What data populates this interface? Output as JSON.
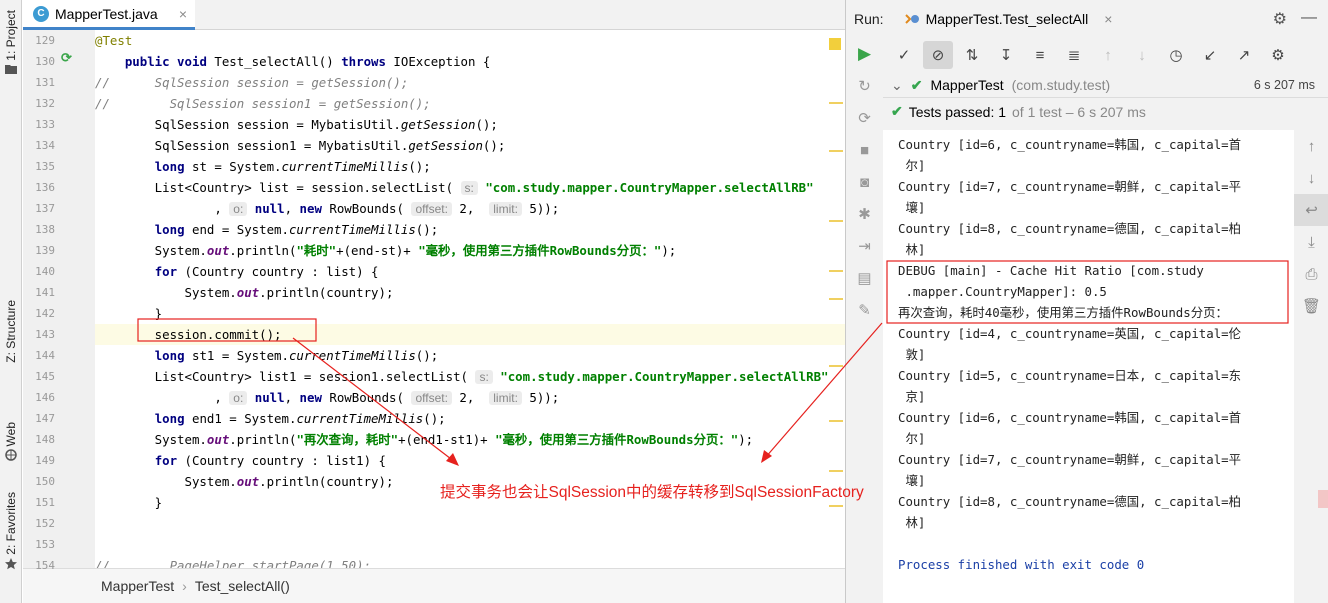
{
  "left_strip": {
    "project": "1: Project",
    "structure": "Z: Structure",
    "web": "Web",
    "favorites": "2: Favorites"
  },
  "editor": {
    "tab": {
      "icon": "C",
      "name": "MapperTest.java",
      "close": "×"
    },
    "lines": [
      {
        "n": "129",
        "html": "<span class=\"ann\">@Test</span>"
      },
      {
        "n": "130",
        "html": "    <span class=\"kw\">public void</span> Test_selectAll() <span class=\"kw\">throws</span> IOException {"
      },
      {
        "n": "131",
        "html": "<span class=\"cmt\">//      SqlSession session = getSession();</span>"
      },
      {
        "n": "132",
        "html": "<span class=\"cmt\">//        SqlSession session1 = getSession();</span>"
      },
      {
        "n": "133",
        "html": "        SqlSession session = MybatisUtil.<span class=\"stat\">getSession</span>();"
      },
      {
        "n": "134",
        "html": "        SqlSession session1 = MybatisUtil.<span class=\"stat\">getSession</span>();"
      },
      {
        "n": "135",
        "html": "        <span class=\"kw\">long</span> st = System.<span class=\"stat\">currentTimeMillis</span>();"
      },
      {
        "n": "136",
        "html": "        List&lt;Country&gt; list = session.selectList( <span class=\"hint\">s:</span> <span class=\"str\">\"com.study.mapper.CountryMapper.selectAllRB\"</span>"
      },
      {
        "n": "137",
        "html": "                , <span class=\"hint\">o:</span> <span class=\"kw\">null</span>, <span class=\"kw\">new</span> RowBounds( <span class=\"hint\">offset:</span> 2,  <span class=\"hint\">limit:</span> 5));"
      },
      {
        "n": "138",
        "html": "        <span class=\"kw\">long</span> end = System.<span class=\"stat\">currentTimeMillis</span>();"
      },
      {
        "n": "139",
        "html": "        System.<span class=\"fld\">out</span>.println(<span class=\"str\">\"耗时\"</span>+(end-st)+ <span class=\"str\">\"毫秒，使用第三方插件RowBounds分页：\"</span>);"
      },
      {
        "n": "140",
        "html": "        <span class=\"kw\">for</span> (Country country : list) {"
      },
      {
        "n": "141",
        "html": "            System.<span class=\"fld\">out</span>.println(country);"
      },
      {
        "n": "142",
        "html": "        }"
      },
      {
        "n": "143",
        "html": "        session.commit();",
        "hl": true
      },
      {
        "n": "144",
        "html": "        <span class=\"kw\">long</span> st1 = System.<span class=\"stat\">currentTimeMillis</span>();"
      },
      {
        "n": "145",
        "html": "        List&lt;Country&gt; list1 = session1.selectList( <span class=\"hint\">s:</span> <span class=\"str\">\"com.study.mapper.CountryMapper.selectAllRB\"</span>"
      },
      {
        "n": "146",
        "html": "                , <span class=\"hint\">o:</span> <span class=\"kw\">null</span>, <span class=\"kw\">new</span> RowBounds( <span class=\"hint\">offset:</span> 2,  <span class=\"hint\">limit:</span> 5));"
      },
      {
        "n": "147",
        "html": "        <span class=\"kw\">long</span> end1 = System.<span class=\"stat\">currentTimeMillis</span>();"
      },
      {
        "n": "148",
        "html": "        System.<span class=\"fld\">out</span>.println(<span class=\"str\">\"再次查询，耗时\"</span>+(end1-st1)+ <span class=\"str\">\"毫秒，使用第三方插件RowBounds分页：\"</span>);"
      },
      {
        "n": "149",
        "html": "        <span class=\"kw\">for</span> (Country country : list1) {"
      },
      {
        "n": "150",
        "html": "            System.<span class=\"fld\">out</span>.println(country);"
      },
      {
        "n": "151",
        "html": "        }"
      },
      {
        "n": "152",
        "html": ""
      },
      {
        "n": "153",
        "html": ""
      },
      {
        "n": "154",
        "html": "<span class=\"cmt\">//        PageHelper.startPage(1,50);</span>"
      }
    ],
    "breadcrumb": [
      "MapperTest",
      "Test_selectAll()"
    ],
    "breadcrumb_sep": "›"
  },
  "run": {
    "label": "Run:",
    "tab": "MapperTest.Test_selectAll",
    "tab_close": "×",
    "tree_root": "MapperTest",
    "tree_pkg": "(com.study.test)",
    "tree_time": "6 s 207 ms",
    "status_main": "Tests passed: 1",
    "status_rest": "of 1 test – 6 s 207 ms",
    "console": [
      "Country [id=6, c_countryname=韩国, c_capital=首",
      " 尔]",
      "Country [id=7, c_countryname=朝鲜, c_capital=平",
      " 壤]",
      "Country [id=8, c_countryname=德国, c_capital=柏",
      " 林]",
      "DEBUG [main] - Cache Hit Ratio [com.study",
      " .mapper.CountryMapper]: 0.5",
      "再次查询，耗时40毫秒，使用第三方插件RowBounds分页：",
      "Country [id=4, c_countryname=英国, c_capital=伦",
      " 敦]",
      "Country [id=5, c_countryname=日本, c_capital=东",
      " 京]",
      "Country [id=6, c_countryname=韩国, c_capital=首",
      " 尔]",
      "Country [id=7, c_countryname=朝鲜, c_capital=平",
      " 壤]",
      "Country [id=8, c_countryname=德国, c_capital=柏",
      " 林]",
      "",
      "Process finished with exit code 0"
    ]
  },
  "annotation": {
    "caption": "提交事务也会让SqlSession中的缓存转移到SqlSessionFactory",
    "color": "#e6211e"
  }
}
